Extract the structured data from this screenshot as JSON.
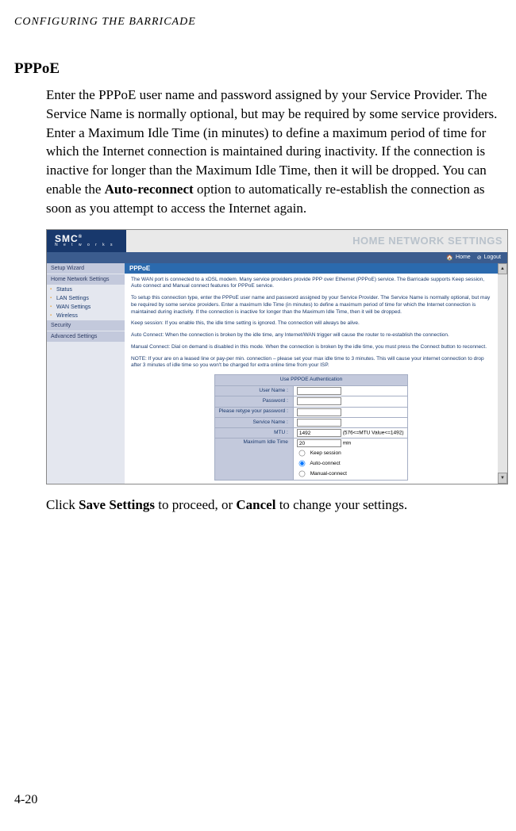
{
  "runningHeader": "CONFIGURING THE BARRICADE",
  "sectionTitle": "PPPoE",
  "paragraph1_a": "Enter the PPPoE user name and password assigned by your Service Provider. The Service Name is normally optional, but may be required by some service providers. Enter a Maximum Idle Time (in minutes) to define a maximum period of time for which the Internet connection is maintained during inactivity. If the connection is inactive for longer than the Maximum Idle Time, then it will be dropped. You can enable the ",
  "paragraph1_bold": "Auto-reconnect",
  "paragraph1_b": " option to automatically re-establish the connection as soon as you attempt to access the Internet again.",
  "paragraph2_a": "Click ",
  "paragraph2_bold1": "Save Settings",
  "paragraph2_b": " to proceed, or ",
  "paragraph2_bold2": "Cancel",
  "paragraph2_c": " to change your settings.",
  "pageNumber": "4-20",
  "screenshot": {
    "logo": {
      "name": "SMC",
      "sub": "N e t w o r k s",
      "reg": "®"
    },
    "bannerText": "HOME NETWORK SETTINGS",
    "topbar": {
      "home": "Home",
      "logout": "Logout"
    },
    "sidebar": {
      "items": [
        {
          "label": "Setup Wizard",
          "type": "main"
        },
        {
          "label": "Home Network Settings",
          "type": "main"
        },
        {
          "label": "Status",
          "type": "sub"
        },
        {
          "label": "LAN Settings",
          "type": "sub"
        },
        {
          "label": "WAN Settings",
          "type": "sub"
        },
        {
          "label": "Wireless",
          "type": "sub"
        },
        {
          "label": "Security",
          "type": "main"
        },
        {
          "label": "Advanced Settings",
          "type": "main"
        }
      ]
    },
    "content": {
      "title": "PPPoE",
      "p1": "The WAN port is connected to a xDSL modem. Many service providers provide PPP over Ethernet (PPPoE) service. The Barricade supports Keep session, Auto connect and Manual connect features for PPPoE service.",
      "p2": "To setup this connection type, enter the PPPoE user name and password assigned by your Service Provider. The Service Name is normally optional, but may be required by some service providers. Enter a maximum Idle Time (in minutes) to define a maximum period of time for which the Internet connection is maintained during inactivity. If the connection is inactive for longer than the Maximum Idle Time, then it will be dropped.",
      "p3": "Keep session: If you enable this, the idle time setting is ignored. The connection will always be alive.",
      "p4": "Auto Connect: When the connection is broken by the idle time, any Internet/WAN trigger will cause the router to re-establish the connection.",
      "p5": "Manual Connect: Dial on demand is disabled in this mode. When the connection is broken by the idle time, you must press the Connect button to reconnect.",
      "p6": "NOTE: If your are on a leased line or pay-per min. connection – please set your max idle time to 3 minutes. This will cause your internet connection to drop after 3 minutes of idle time so you won't be charged for extra online time from your ISP.",
      "form": {
        "header": "Use PPPOE Authentication",
        "rows": {
          "username": {
            "label": "User Name :",
            "value": ""
          },
          "password": {
            "label": "Password :",
            "value": ""
          },
          "retype": {
            "label": "Please retype your password :",
            "value": ""
          },
          "service": {
            "label": "Service Name :",
            "value": ""
          },
          "mtu": {
            "label": "MTU :",
            "value": "1492",
            "hint": "(576<=MTU Value<=1492)"
          },
          "maxidle": {
            "label": "Maximum Idle Time",
            "value": "20",
            "unit": "min"
          }
        },
        "radios": {
          "keep": "Keep session",
          "auto": "Auto-connect",
          "manual": "Manual-connect"
        }
      }
    }
  }
}
